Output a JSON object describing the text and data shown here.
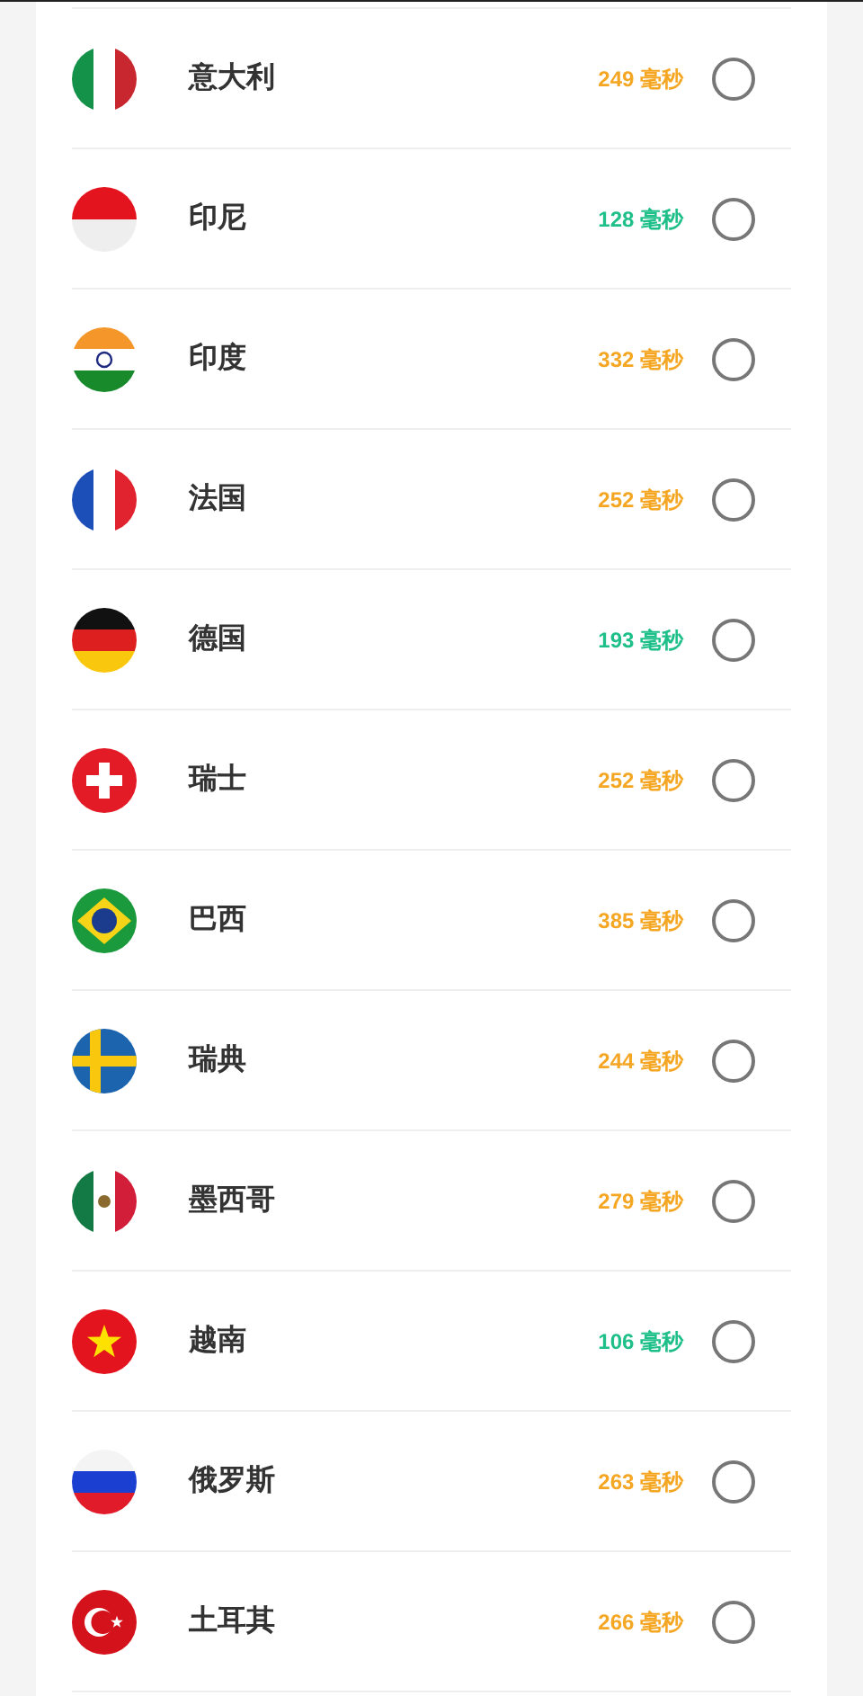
{
  "servers": [
    {
      "name": "意大利",
      "latency": "249 毫秒",
      "color": "#f5a623",
      "selected": false
    },
    {
      "name": "印尼",
      "latency": "128 毫秒",
      "color": "#1fbf8a",
      "selected": false
    },
    {
      "name": "印度",
      "latency": "332 毫秒",
      "color": "#f5a623",
      "selected": false
    },
    {
      "name": "法国",
      "latency": "252 毫秒",
      "color": "#f5a623",
      "selected": false
    },
    {
      "name": "德国",
      "latency": "193 毫秒",
      "color": "#1fbf8a",
      "selected": false
    },
    {
      "name": "瑞士",
      "latency": "252 毫秒",
      "color": "#f5a623",
      "selected": false
    },
    {
      "name": "巴西",
      "latency": "385 毫秒",
      "color": "#f5a623",
      "selected": false
    },
    {
      "name": "瑞典",
      "latency": "244 毫秒",
      "color": "#f5a623",
      "selected": false
    },
    {
      "name": "墨西哥",
      "latency": "279 毫秒",
      "color": "#f5a623",
      "selected": false
    },
    {
      "name": "越南",
      "latency": "106 毫秒",
      "color": "#1fbf8a",
      "selected": false
    },
    {
      "name": "俄罗斯",
      "latency": "263 毫秒",
      "color": "#f5a623",
      "selected": false
    },
    {
      "name": "土耳其",
      "latency": "266 毫秒",
      "color": "#f5a623",
      "selected": false
    }
  ]
}
